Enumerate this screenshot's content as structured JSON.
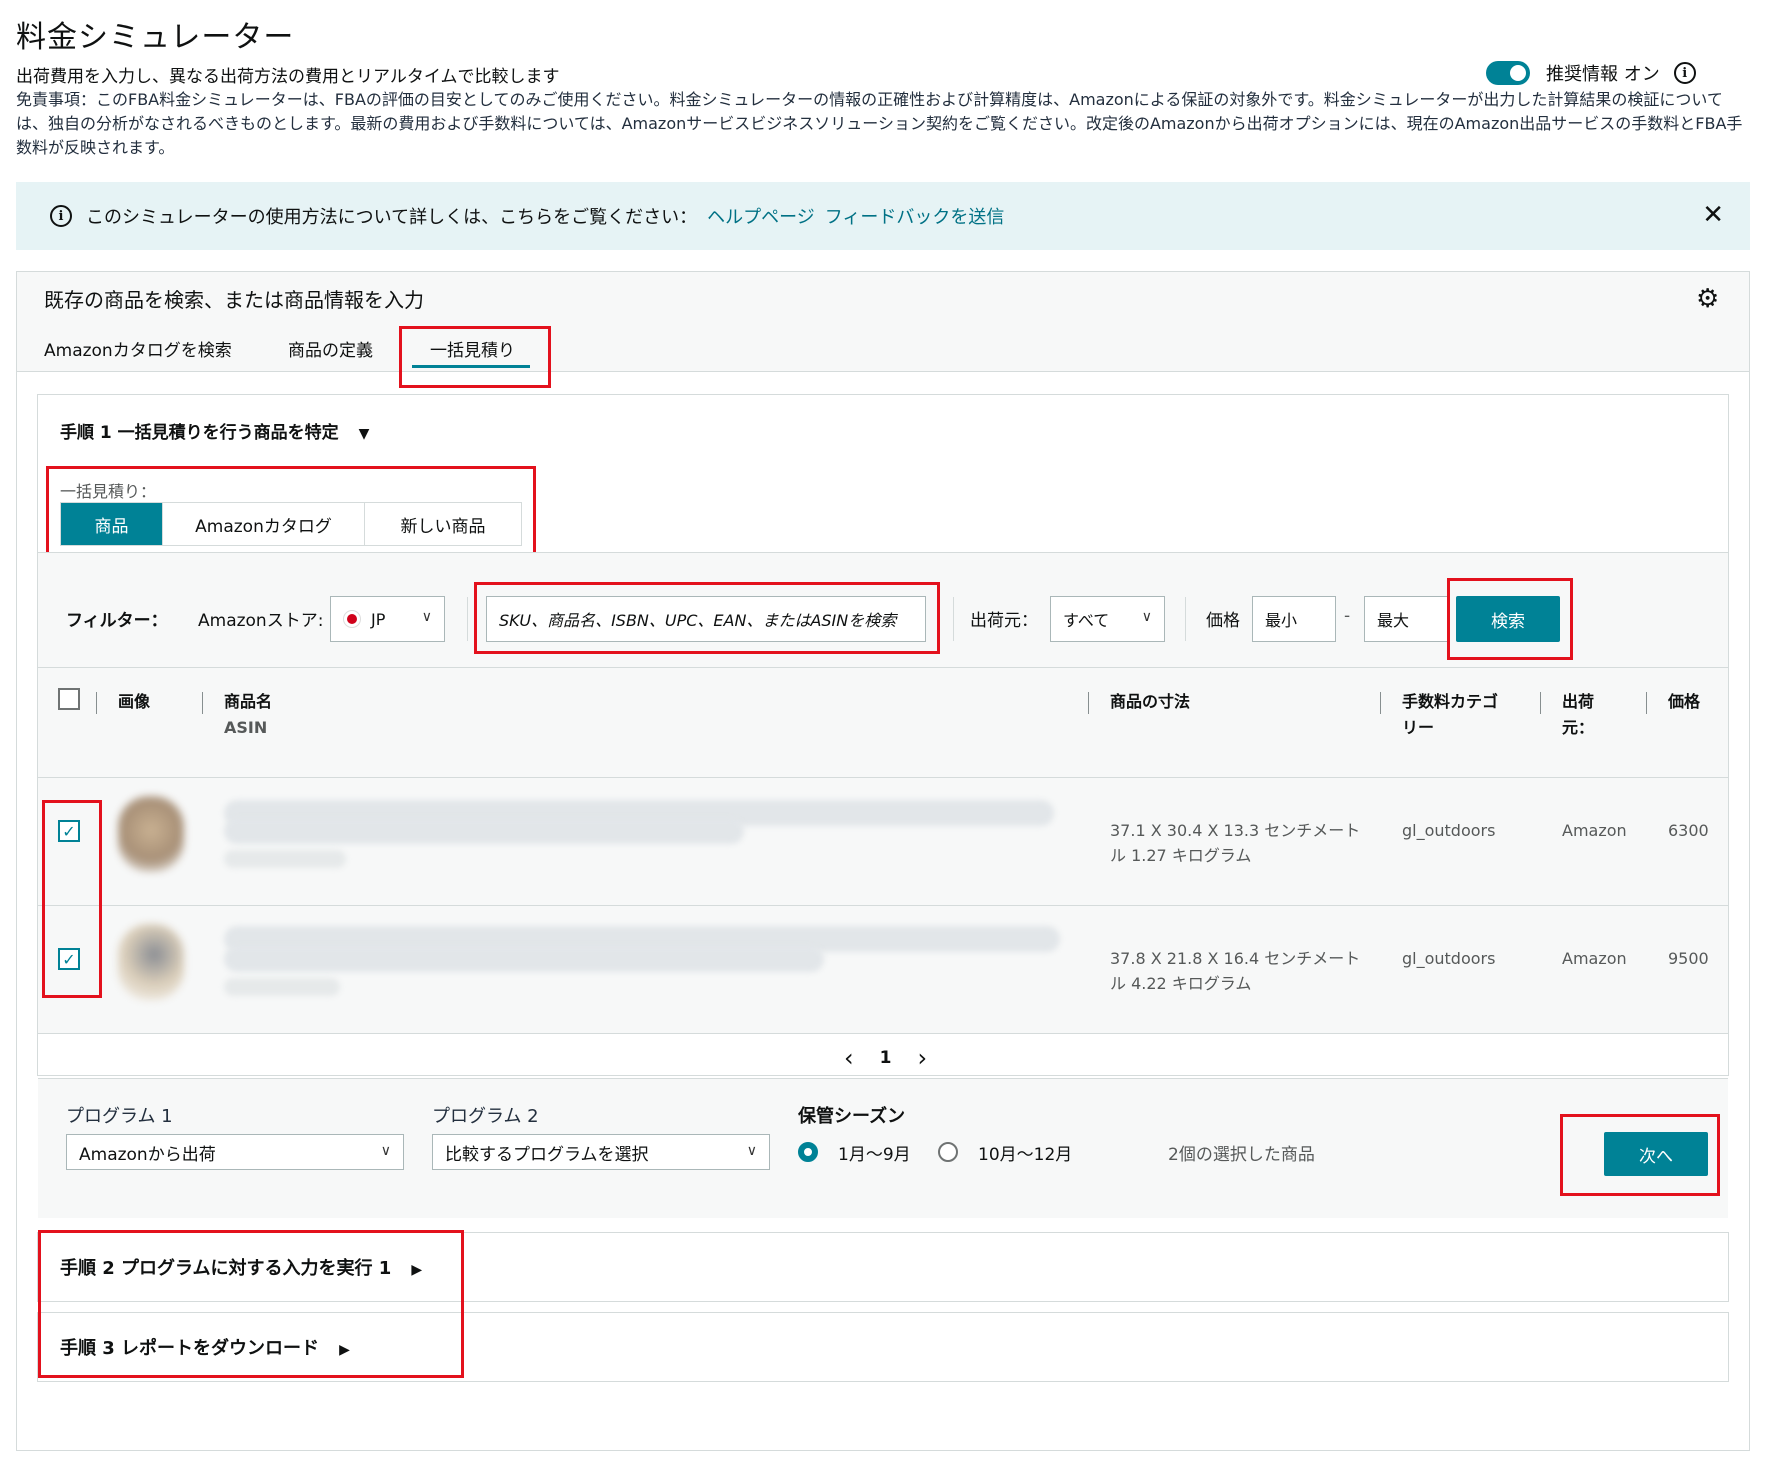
{
  "header": {
    "title": "料金シミュレーター",
    "subtitle": "出荷費用を入力し、異なる出荷方法の費用とリアルタイムで比較します",
    "disclaimer": "免責事項：このFBA料金シミュレーターは、FBAの評価の目安としてのみご使用ください。料金シミュレーターの情報の正確性および計算精度は、Amazonによる保証の対象外です。料金シミュレーターが出力した計算結果の検証については、独自の分析がなされるべきものとします。最新の費用および手数料については、Amazonサービスビジネスソリューション契約をご覧ください。改定後のAmazonから出荷オプションには、現在のAmazon出品サービスの手数料とFBA手数料が反映されます。",
    "recommend_label": "推奨情報 オン"
  },
  "alert": {
    "text": "このシミュレーターの使用方法について詳しくは、こちらをご覧ください：",
    "help_link": "ヘルプページ",
    "feedback_link": "フィードバックを送信",
    "close": "✕"
  },
  "panel": {
    "title": "既存の商品を検索、または商品情報を入力",
    "tabs": [
      "Amazonカタログを検索",
      "商品の定義",
      "一括見積り"
    ]
  },
  "step1": {
    "title": "手順 1 一括見積りを行う商品を特定",
    "bulk_label": "一括見積り：",
    "segments": [
      "商品",
      "Amazonカタログ",
      "新しい商品"
    ],
    "filter": {
      "label": "フィルター：",
      "store_label": "Amazonストア:",
      "store_value": "JP",
      "search_placeholder": "SKU、商品名、ISBN、UPC、EAN、またはASINを検索",
      "ship_from_label": "出荷元：",
      "ship_from_value": "すべて",
      "price_label": "価格",
      "price_min": "最小",
      "price_dash": "-",
      "price_max": "最大",
      "search_button": "検索"
    },
    "table": {
      "headers": {
        "image": "画像",
        "name": "商品名",
        "asin": "ASIN",
        "dimensions": "商品の寸法",
        "fee_category_1": "手数料カテゴ",
        "fee_category_2": "リー",
        "ship_from_1": "出荷",
        "ship_from_2": "元：",
        "price": "価格"
      },
      "rows": [
        {
          "dims_1": "37.1 X 30.4 X 13.3 センチメート",
          "dims_2": "ル 1.27 キログラム",
          "fee_category": "gl_outdoors",
          "ship_from": "Amazon",
          "price": "6300"
        },
        {
          "dims_1": "37.8 X 21.8 X 16.4 センチメート",
          "dims_2": "ル 4.22 キログラム",
          "fee_category": "gl_outdoors",
          "ship_from": "Amazon",
          "price": "9500"
        }
      ]
    },
    "pager": {
      "prev": "‹",
      "page": "1",
      "next": "›"
    },
    "program": {
      "program1_label": "プログラム 1",
      "program1_value": "Amazonから出荷",
      "program2_label": "プログラム 2",
      "program2_value": "比較するプログラムを選択",
      "season_label": "保管シーズン",
      "season_options": [
        "1月～9月",
        "10月～12月"
      ],
      "selected_count": "2個の選択した商品",
      "next_button": "次へ"
    }
  },
  "step2": {
    "title": "手順 2 プログラムに対する入力を実行 1"
  },
  "step3": {
    "title": "手順 3 レポートをダウンロード"
  },
  "colors": {
    "accent": "#008296",
    "link": "#007185",
    "alert_bg": "#e6f3f5",
    "highlight": "#e3111d"
  }
}
